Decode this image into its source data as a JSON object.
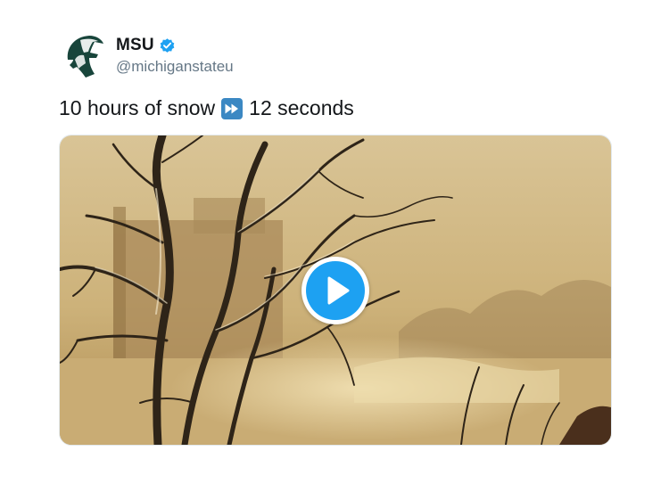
{
  "tweet": {
    "display_name": "MSU",
    "handle": "@michiganstateu",
    "verified": true,
    "text_before": "10 hours of snow",
    "emoji": "fast-forward-button",
    "text_after": "12 seconds",
    "media": {
      "type": "video",
      "play_icon": "play-icon"
    }
  },
  "colors": {
    "text": "#14171a",
    "handle": "#657786",
    "verified_blue": "#1da1f2",
    "msu_green": "#18453b",
    "play_blue": "#1da1f2"
  }
}
